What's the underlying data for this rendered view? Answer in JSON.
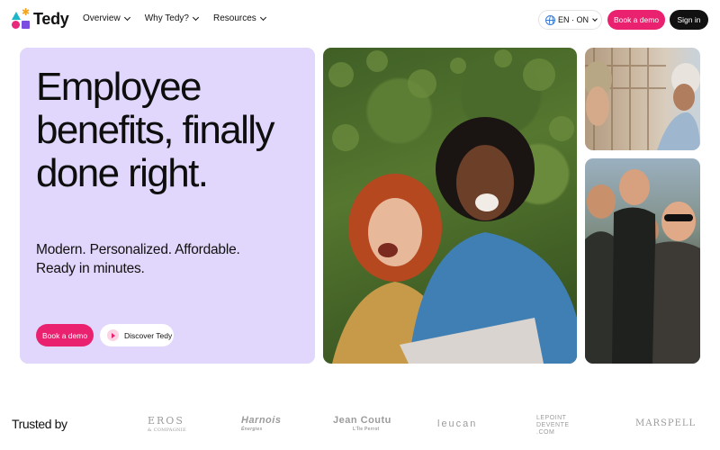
{
  "brand": {
    "name": "Tedy"
  },
  "nav": {
    "links": [
      {
        "label": "Overview"
      },
      {
        "label": "Why Tedy?"
      },
      {
        "label": "Resources"
      }
    ],
    "language": "EN · ON",
    "book_demo": "Book a demo",
    "sign_in": "Sign in"
  },
  "hero": {
    "headline": "Employee benefits, finally done right.",
    "subhead_line1": "Modern. Personalized. Affordable.",
    "subhead_line2": "Ready in minutes.",
    "cta_primary": "Book a demo",
    "cta_secondary": "Discover Tedy",
    "background_color": "#e1d6fb",
    "accent_color": "#e9216f"
  },
  "trusted": {
    "label": "Trusted by",
    "logos": [
      {
        "name": "EROS",
        "sub": "& COMPAGNIE"
      },
      {
        "name": "Harnois",
        "sub": "Énergies"
      },
      {
        "name": "Jean Coutu",
        "sub": "L'Île Perrot"
      },
      {
        "name": "leucan"
      },
      {
        "name": "LEPOINT DEVENTE .COM"
      },
      {
        "name": "MARSPELL"
      }
    ]
  }
}
